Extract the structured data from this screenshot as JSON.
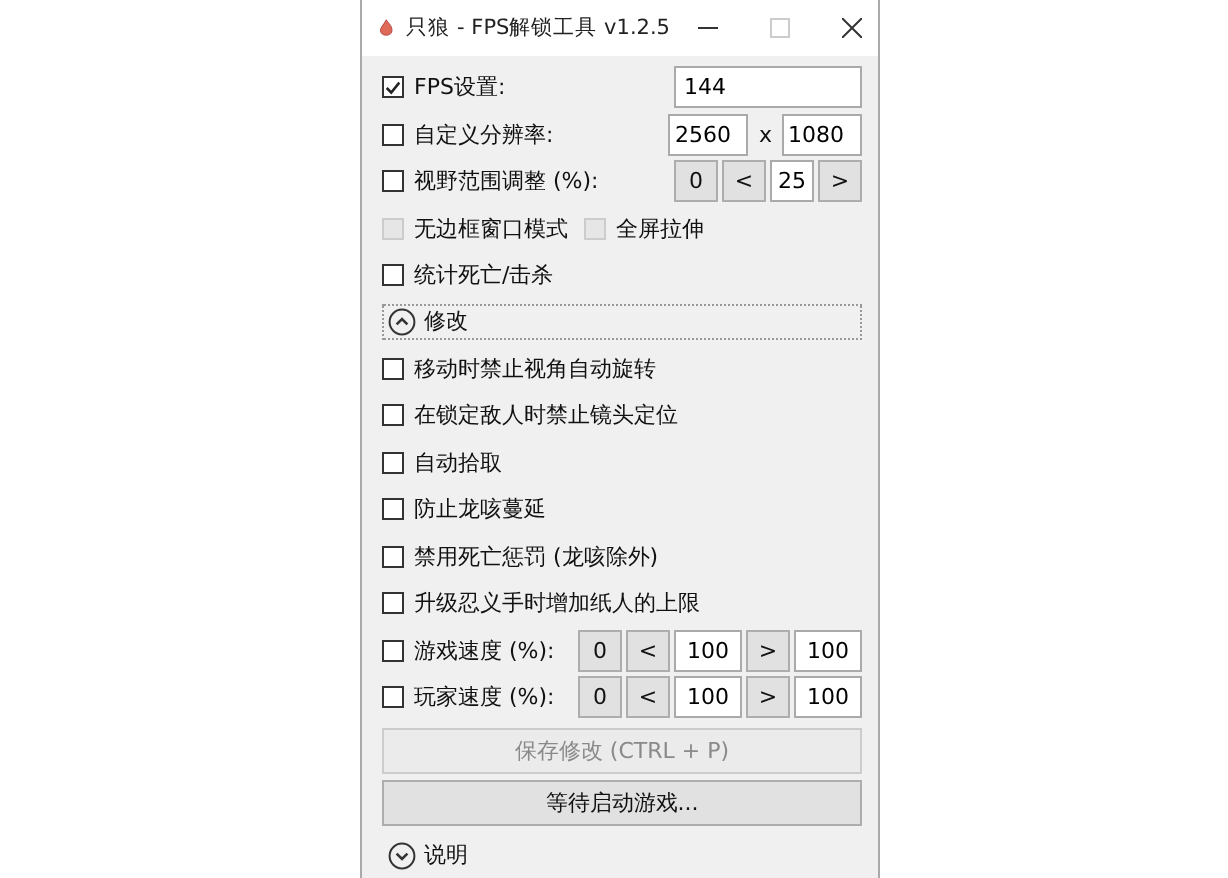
{
  "window": {
    "title": "只狼 - FPS解锁工具 v1.2.5"
  },
  "settings": [
    {
      "label": "FPS设置:",
      "checked": true,
      "controls": [
        {
          "kind": "wide-field",
          "text": "144"
        }
      ]
    },
    {
      "label": "自定义分辨率:",
      "checked": false,
      "controls": [
        {
          "kind": "field",
          "text": "2560"
        },
        {
          "kind": "text",
          "text": "x"
        },
        {
          "kind": "field",
          "text": "1080"
        }
      ]
    },
    {
      "label": "视野范围调整 (%):",
      "checked": false,
      "controls": [
        {
          "kind": "button",
          "text": "0"
        },
        {
          "kind": "button",
          "text": "<"
        },
        {
          "kind": "field",
          "text": "25"
        },
        {
          "kind": "button",
          "text": ">"
        }
      ]
    }
  ],
  "window_modes": [
    {
      "label": "无边框窗口模式",
      "checked": false,
      "disabled": true
    },
    {
      "label": "全屏拉伸",
      "checked": false,
      "disabled": true
    }
  ],
  "stats": {
    "label": "统计死亡/击杀",
    "checked": false
  },
  "mods_section": {
    "label": "修改",
    "expanded": true
  },
  "mods": [
    {
      "label": "移动时禁止视角自动旋转",
      "checked": false
    },
    {
      "label": "在锁定敌人时禁止镜头定位",
      "checked": false
    },
    {
      "label": "自动拾取",
      "checked": false
    },
    {
      "label": "防止龙咳蔓延",
      "checked": false
    },
    {
      "label": "禁用死亡惩罚 (龙咳除外)",
      "checked": false
    },
    {
      "label": "升级忍义手时增加纸人的上限",
      "checked": false
    }
  ],
  "speeds": [
    {
      "label": "游戏速度 (%):",
      "checked": false,
      "controls": [
        {
          "kind": "button",
          "text": "0"
        },
        {
          "kind": "button",
          "text": "<"
        },
        {
          "kind": "field",
          "text": "100"
        },
        {
          "kind": "button",
          "text": ">"
        },
        {
          "kind": "field",
          "text": "100"
        }
      ]
    },
    {
      "label": "玩家速度 (%):",
      "checked": false,
      "controls": [
        {
          "kind": "button",
          "text": "0"
        },
        {
          "kind": "button",
          "text": "<"
        },
        {
          "kind": "field",
          "text": "100"
        },
        {
          "kind": "button",
          "text": ">"
        },
        {
          "kind": "field",
          "text": "100"
        }
      ]
    }
  ],
  "actions": [
    {
      "label": "保存修改 (CTRL + P)",
      "disabled": true
    },
    {
      "label": "等待启动游戏...",
      "disabled": false
    }
  ],
  "help_section": {
    "label": "说明",
    "expanded": false
  }
}
